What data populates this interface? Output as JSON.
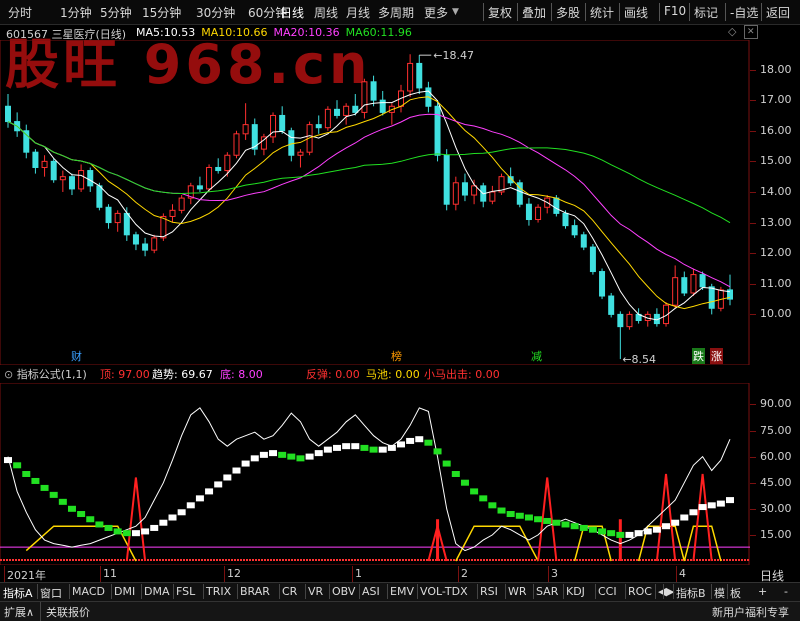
{
  "toolbar": {
    "left": [
      "分时",
      "1分钟",
      "5分钟",
      "15分钟",
      "30分钟",
      "60分钟",
      "日线",
      "周线",
      "月线",
      "多周期",
      "更多"
    ],
    "right": [
      "复权",
      "叠加",
      "多股",
      "统计",
      "画线",
      "F10",
      "标记",
      "-自选",
      "返回"
    ]
  },
  "watermark": "股旺 968.cn",
  "stock": {
    "code": "601567",
    "name": "三星医疗(日线)"
  },
  "ma": [
    {
      "label": "MA5:",
      "value": "10.53",
      "color": "#ffffff"
    },
    {
      "label": "MA10:",
      "value": "10.66",
      "color": "#ffd800"
    },
    {
      "label": "MA20:",
      "value": "10.36",
      "color": "#ff40ff"
    },
    {
      "label": "MA60:",
      "value": "11.96",
      "color": "#22e022"
    }
  ],
  "price_axis": [
    "18.00",
    "17.00",
    "16.00",
    "15.00",
    "14.00",
    "13.00",
    "12.00",
    "11.00",
    "10.00"
  ],
  "high_label": "18.47",
  "low_label": "8.54",
  "markers": [
    {
      "text": "财",
      "bg": "#000",
      "color": "#3aa0ff"
    },
    {
      "text": "榜",
      "bg": "#000",
      "color": "#ff9a00"
    },
    {
      "text": "减",
      "bg": "#000",
      "color": "#22e022"
    },
    {
      "text": "跌",
      "bg": "#1a7a1a",
      "color": "#ffffff"
    },
    {
      "text": "涨",
      "bg": "#8a1010",
      "color": "#ffffff"
    }
  ],
  "indicator": {
    "name": "指标公式(1,1)",
    "items": [
      {
        "label": "顶: ",
        "value": "97.00",
        "color": "#ff3030"
      },
      {
        "label": "趋势: ",
        "value": "69.67",
        "color": "#ffffff"
      },
      {
        "label": "底: ",
        "value": "8.00",
        "color": "#ff40ff"
      },
      {
        "label": "反弹: ",
        "value": "0.00",
        "color": "#ff3030"
      },
      {
        "label": "马池: ",
        "value": "0.00",
        "color": "#ffd800"
      },
      {
        "label": "小马出击: ",
        "value": "0.00",
        "color": "#ff3030"
      }
    ],
    "axis": [
      "90.00",
      "75.00",
      "60.00",
      "45.00",
      "30.00",
      "15.00"
    ]
  },
  "date_axis": [
    "2021年",
    "11",
    "12",
    "1",
    "2",
    "3",
    "4"
  ],
  "period_label": "日线",
  "tabs": [
    "指标A",
    "窗口",
    "MACD",
    "DMI",
    "DMA",
    "FSL",
    "TRIX",
    "BRAR",
    "CR",
    "VR",
    "OBV",
    "ASI",
    "EMV",
    "VOL-TDX",
    "RSI",
    "WR",
    "SAR",
    "KDJ",
    "CCI",
    "ROC",
    "◀",
    "▶",
    "指标B",
    "模",
    "板"
  ],
  "tab_right": [
    "+",
    "-"
  ],
  "status": {
    "left": [
      "扩展∧",
      "关联报价"
    ],
    "right": "新用户福利专享"
  },
  "colors": {
    "up": "#ff3030",
    "down": "#40e0e0",
    "ma5": "#ffffff",
    "ma10": "#ffd800",
    "ma20": "#ff40ff",
    "ma60": "#22e022"
  },
  "chart_data": {
    "type": "candlestick",
    "price_range": [
      9.0,
      18.9
    ],
    "candles": [
      [
        16.8,
        17.2,
        16.1,
        16.3
      ],
      [
        16.3,
        16.6,
        15.8,
        16.0
      ],
      [
        16.0,
        16.2,
        15.1,
        15.3
      ],
      [
        15.3,
        15.4,
        14.6,
        14.8
      ],
      [
        14.8,
        15.2,
        14.5,
        15.0
      ],
      [
        15.0,
        15.1,
        14.3,
        14.4
      ],
      [
        14.4,
        14.7,
        14.0,
        14.5
      ],
      [
        14.5,
        14.6,
        13.9,
        14.1
      ],
      [
        14.1,
        14.9,
        14.0,
        14.7
      ],
      [
        14.7,
        14.8,
        14.0,
        14.2
      ],
      [
        14.2,
        14.3,
        13.4,
        13.5
      ],
      [
        13.5,
        13.6,
        12.8,
        13.0
      ],
      [
        13.0,
        13.4,
        12.7,
        13.3
      ],
      [
        13.3,
        13.5,
        12.4,
        12.6
      ],
      [
        12.6,
        12.7,
        12.1,
        12.3
      ],
      [
        12.3,
        12.5,
        11.9,
        12.1
      ],
      [
        12.1,
        12.6,
        12.0,
        12.5
      ],
      [
        12.5,
        13.3,
        12.4,
        13.2
      ],
      [
        13.2,
        13.6,
        13.0,
        13.4
      ],
      [
        13.4,
        13.9,
        13.3,
        13.8
      ],
      [
        13.8,
        14.3,
        13.6,
        14.2
      ],
      [
        14.2,
        14.5,
        14.0,
        14.1
      ],
      [
        14.1,
        14.9,
        14.0,
        14.8
      ],
      [
        14.8,
        15.1,
        14.6,
        14.7
      ],
      [
        14.7,
        15.3,
        14.5,
        15.2
      ],
      [
        15.2,
        16.0,
        15.1,
        15.9
      ],
      [
        15.9,
        16.9,
        15.7,
        16.2
      ],
      [
        16.2,
        16.4,
        15.2,
        15.4
      ],
      [
        15.4,
        15.9,
        15.2,
        15.8
      ],
      [
        15.8,
        16.6,
        15.6,
        16.5
      ],
      [
        16.5,
        16.8,
        15.9,
        16.0
      ],
      [
        16.0,
        16.1,
        15.0,
        15.2
      ],
      [
        15.2,
        15.4,
        14.8,
        15.3
      ],
      [
        15.3,
        16.3,
        15.2,
        16.2
      ],
      [
        16.2,
        16.5,
        15.9,
        16.1
      ],
      [
        16.1,
        16.8,
        16.0,
        16.7
      ],
      [
        16.7,
        17.0,
        16.4,
        16.5
      ],
      [
        16.5,
        16.9,
        16.2,
        16.8
      ],
      [
        16.8,
        17.2,
        16.5,
        16.6
      ],
      [
        16.6,
        17.7,
        16.4,
        17.6
      ],
      [
        17.6,
        17.8,
        16.8,
        17.0
      ],
      [
        17.0,
        17.3,
        16.5,
        16.6
      ],
      [
        16.6,
        16.9,
        16.2,
        16.8
      ],
      [
        16.8,
        17.5,
        16.6,
        17.3
      ],
      [
        17.3,
        18.5,
        17.1,
        18.2
      ],
      [
        18.2,
        18.47,
        17.2,
        17.4
      ],
      [
        17.4,
        17.6,
        16.6,
        16.8
      ],
      [
        16.8,
        17.0,
        15.0,
        15.2
      ],
      [
        15.2,
        15.4,
        13.4,
        13.6
      ],
      [
        13.6,
        14.5,
        13.4,
        14.3
      ],
      [
        14.3,
        14.6,
        13.7,
        13.9
      ],
      [
        13.9,
        14.4,
        13.6,
        14.2
      ],
      [
        14.2,
        14.3,
        13.5,
        13.7
      ],
      [
        13.7,
        14.2,
        13.6,
        14.0
      ],
      [
        14.0,
        14.6,
        13.9,
        14.5
      ],
      [
        14.5,
        14.8,
        14.2,
        14.3
      ],
      [
        14.3,
        14.4,
        13.5,
        13.6
      ],
      [
        13.6,
        13.8,
        12.9,
        13.1
      ],
      [
        13.1,
        13.6,
        13.0,
        13.5
      ],
      [
        13.5,
        13.9,
        13.3,
        13.8
      ],
      [
        13.8,
        13.9,
        13.2,
        13.3
      ],
      [
        13.3,
        13.4,
        12.8,
        12.9
      ],
      [
        12.9,
        13.1,
        12.5,
        12.6
      ],
      [
        12.6,
        12.7,
        12.1,
        12.2
      ],
      [
        12.2,
        12.3,
        11.3,
        11.4
      ],
      [
        11.4,
        11.5,
        10.5,
        10.6
      ],
      [
        10.6,
        10.7,
        9.9,
        10.0
      ],
      [
        10.0,
        10.1,
        8.54,
        9.6
      ],
      [
        9.6,
        10.1,
        9.5,
        10.0
      ],
      [
        10.0,
        10.2,
        9.7,
        9.8
      ],
      [
        9.8,
        10.1,
        9.6,
        10.0
      ],
      [
        10.0,
        10.2,
        9.6,
        9.7
      ],
      [
        9.7,
        10.4,
        9.6,
        10.3
      ],
      [
        10.3,
        11.6,
        10.2,
        11.2
      ],
      [
        11.2,
        11.4,
        10.6,
        10.7
      ],
      [
        10.7,
        11.5,
        10.6,
        11.3
      ],
      [
        11.3,
        11.4,
        10.8,
        10.9
      ],
      [
        10.9,
        11.0,
        10.0,
        10.2
      ],
      [
        10.2,
        10.9,
        10.1,
        10.8
      ],
      [
        10.8,
        11.3,
        10.3,
        10.5
      ]
    ],
    "indicator_range": [
      0,
      100
    ],
    "white_line": [
      60,
      40,
      28,
      18,
      12,
      10,
      9,
      8,
      9,
      10,
      12,
      14,
      16,
      18,
      20,
      25,
      35,
      45,
      58,
      72,
      84,
      88,
      80,
      70,
      66,
      70,
      72,
      74,
      70,
      72,
      78,
      85,
      80,
      70,
      66,
      70,
      74,
      80,
      84,
      78,
      72,
      68,
      66,
      70,
      78,
      88,
      86,
      60,
      30,
      10,
      6,
      8,
      12,
      15,
      20,
      18,
      15,
      12,
      15,
      20,
      22,
      24,
      22,
      20,
      18,
      15,
      12,
      10,
      12,
      15,
      20,
      25,
      30,
      35,
      45,
      55,
      60,
      52,
      58,
      70
    ],
    "trend_line": [
      58,
      55,
      50,
      46,
      42,
      38,
      34,
      30,
      27,
      24,
      21,
      19,
      17,
      16,
      16,
      17,
      19,
      22,
      25,
      28,
      32,
      36,
      40,
      44,
      48,
      52,
      56,
      59,
      61,
      62,
      61,
      60,
      59,
      60,
      62,
      64,
      65,
      66,
      66,
      65,
      64,
      64,
      65,
      67,
      69,
      70,
      68,
      63,
      56,
      50,
      45,
      40,
      36,
      32,
      29,
      27,
      26,
      25,
      24,
      23,
      22,
      21,
      20,
      19,
      18,
      17,
      16,
      15,
      15,
      16,
      17,
      18,
      20,
      22,
      25,
      28,
      31,
      32,
      33,
      35
    ],
    "bottom_line": 8.0,
    "red_spikes": [
      [
        13,
        0
      ],
      [
        14,
        48
      ],
      [
        15,
        0
      ],
      [
        46,
        0
      ],
      [
        47,
        20
      ],
      [
        48,
        0
      ],
      [
        58,
        0
      ],
      [
        59,
        48
      ],
      [
        60,
        0
      ],
      [
        71,
        0
      ],
      [
        72,
        50
      ],
      [
        73,
        0
      ],
      [
        75,
        0
      ],
      [
        76,
        50
      ],
      [
        77,
        0
      ]
    ],
    "yellow_segments": [
      [
        2,
        6
      ],
      [
        5,
        20
      ],
      [
        12,
        20
      ],
      [
        14,
        0
      ],
      [
        49,
        0
      ],
      [
        51,
        20
      ],
      [
        56,
        20
      ],
      [
        58,
        0
      ],
      [
        62,
        0
      ],
      [
        63,
        20
      ],
      [
        65,
        20
      ],
      [
        66,
        0
      ],
      [
        69,
        0
      ],
      [
        70,
        20
      ],
      [
        73,
        20
      ],
      [
        74,
        0
      ],
      [
        74,
        0
      ],
      [
        75,
        20
      ],
      [
        77,
        20
      ],
      [
        78,
        0
      ]
    ]
  }
}
